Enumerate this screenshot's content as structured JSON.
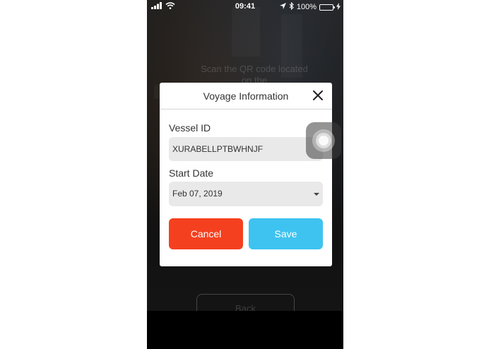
{
  "status_bar": {
    "time": "09:41",
    "battery_text": "100%",
    "battery_level": 1.0,
    "icons": [
      "signal-icon",
      "wifi-icon",
      "location-icon",
      "bluetooth-icon",
      "battery-icon",
      "charging-icon"
    ]
  },
  "background": {
    "scan_instruction": "Scan the QR code located on the",
    "back_label": "Back"
  },
  "modal": {
    "title": "Voyage Information",
    "close_icon": "close-icon",
    "vessel_id_label": "Vessel ID",
    "vessel_id_value": "XURABELLPTBWHNJF",
    "start_date_label": "Start Date",
    "start_date_value": "Feb 07, 2019",
    "cancel_label": "Cancel",
    "save_label": "Save"
  },
  "colors": {
    "cancel": "#f5401f",
    "save": "#3ec3f0",
    "field_bg": "#e9e9e9"
  }
}
